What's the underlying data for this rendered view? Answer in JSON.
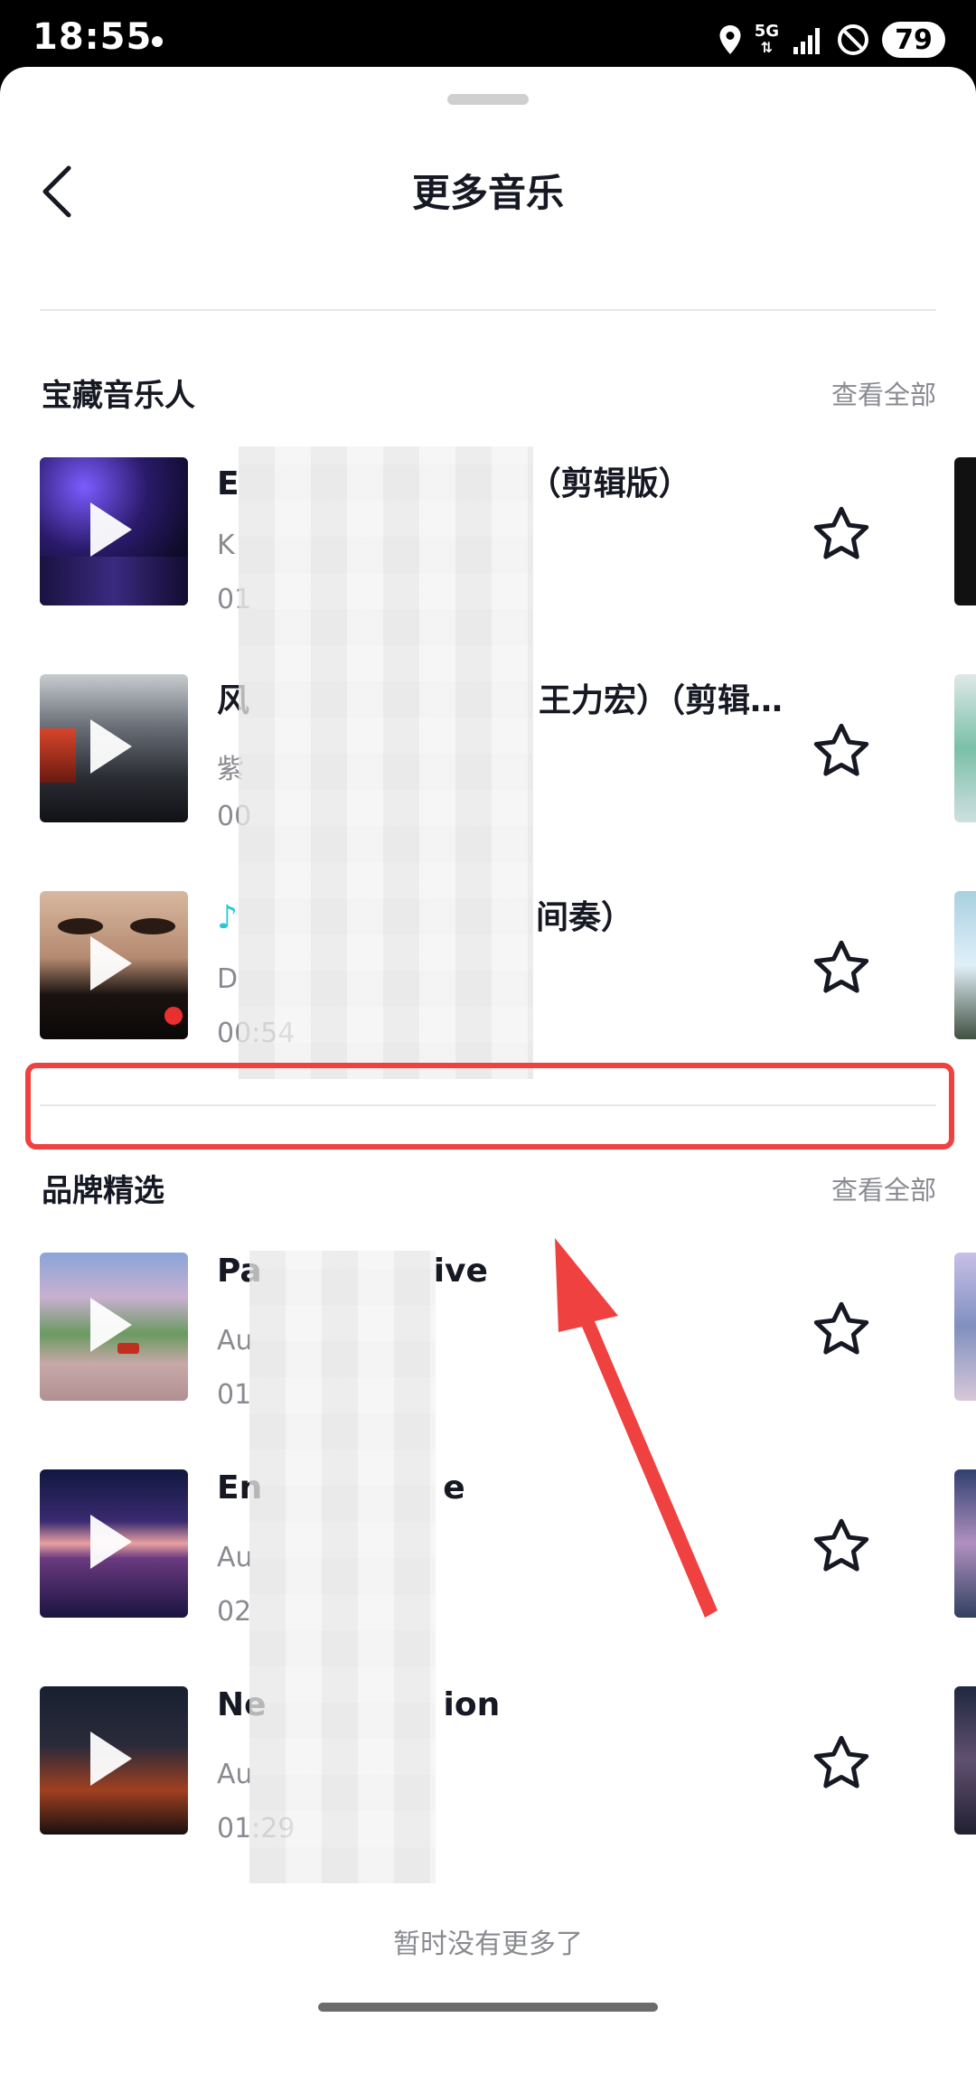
{
  "status_bar": {
    "time": "18:55",
    "network": "5G",
    "battery": "79"
  },
  "header": {
    "title": "更多音乐"
  },
  "sections": [
    {
      "title": "宝藏音乐人",
      "view_all": "查看全部",
      "tracks": [
        {
          "name": "E",
          "name_suffix": "（剪辑版）",
          "artist": "K",
          "duration": "01"
        },
        {
          "name": "风",
          "name_suffix": "王力宏）（剪辑…",
          "artist": "紫",
          "duration": "00"
        },
        {
          "name": "",
          "name_suffix": "间奏）",
          "artist": "D",
          "duration": "00:54"
        }
      ]
    },
    {
      "title": "品牌精选",
      "view_all": "查看全部",
      "tracks": [
        {
          "name": "Pa",
          "name_suffix": "ive",
          "artist": "Au",
          "duration": "01"
        },
        {
          "name": "En",
          "name_suffix": "e",
          "artist": "Au",
          "duration": "02"
        },
        {
          "name": "Ne",
          "name_suffix": "ion",
          "artist": "Au",
          "duration": "01:29"
        }
      ]
    }
  ],
  "footer": {
    "no_more": "暂时没有更多了"
  },
  "colors": {
    "highlight": "#f04141",
    "secondary_text": "#8a8b91",
    "primary_text": "#161823"
  }
}
